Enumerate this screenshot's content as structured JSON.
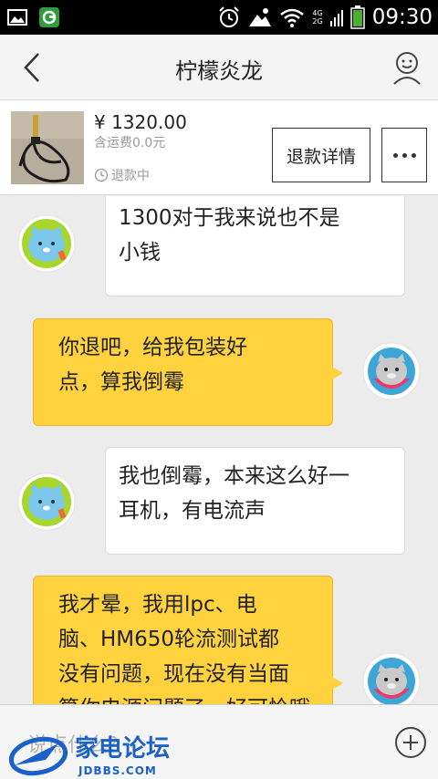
{
  "status_bar": {
    "time": "09:30",
    "network_top": "4G",
    "network_bottom": "2G",
    "icons": [
      "image-icon",
      "shield-app-icon",
      "alarm-icon",
      "weather-icon",
      "wifi-icon",
      "signal-icon",
      "battery-icon"
    ]
  },
  "header": {
    "title": "柠檬炎龙",
    "back_icon": "chevron-left-icon",
    "profile_icon": "user-face-icon"
  },
  "product": {
    "price": "¥ 1320.00",
    "shipping": "含运费0.0元",
    "status": "退款中",
    "refund_button": "退款详情",
    "more_icon": "more-dots-icon"
  },
  "messages": [
    {
      "side": "in",
      "lines": [
        "1300对于我来说也不是",
        "小钱"
      ]
    },
    {
      "side": "out",
      "lines": [
        "你退吧，给我包装好",
        "点，算我倒霉"
      ]
    },
    {
      "side": "in",
      "lines": [
        "我也倒霉，本来这么好一",
        "耳机，有电流声"
      ]
    },
    {
      "side": "out",
      "lines": [
        "我才晕，我用lpc、电",
        "脑、HM650轮流测试都",
        "没有问题，现在没有当面",
        "算你电源问题了，好可怜哦"
      ]
    }
  ],
  "input": {
    "placeholder": "说点什么？",
    "watermark_cn": "家电论坛",
    "watermark_en": "JDBBS.COM"
  },
  "colors": {
    "out_bubble": "#ffd23e",
    "in_bubble": "#ffffff",
    "background": "#ececec",
    "watermark_blue": "#1a62c9"
  }
}
